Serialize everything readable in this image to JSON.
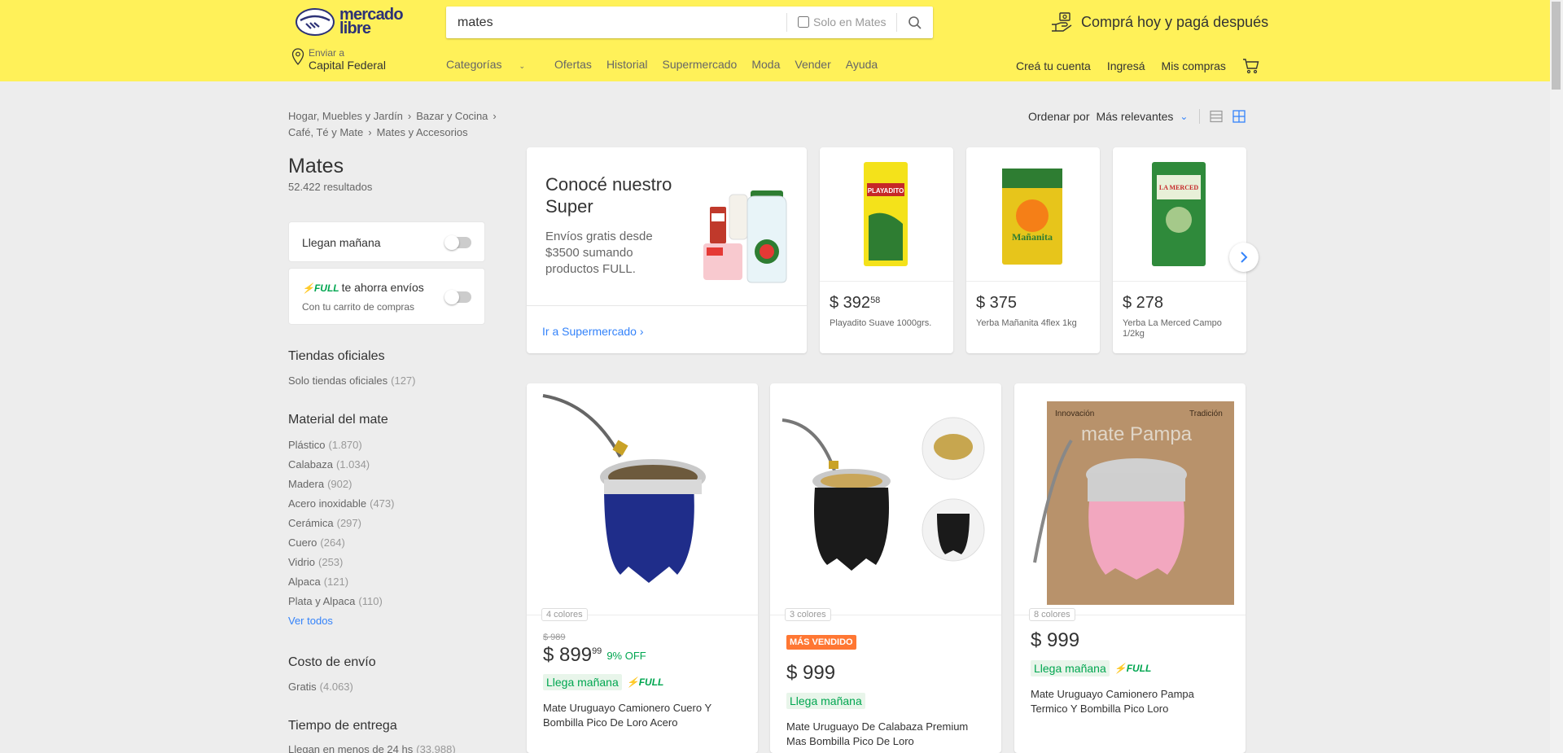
{
  "header": {
    "logo_text": "mercado libre",
    "search_value": "mates",
    "search_scope_label": "Solo en Mates",
    "promo_text": "Comprá hoy y pagá después",
    "location_small": "Enviar a",
    "location_big": "Capital Federal",
    "nav": [
      "Categorías",
      "Ofertas",
      "Historial",
      "Supermercado",
      "Moda",
      "Vender",
      "Ayuda"
    ],
    "user_nav": [
      "Creá tu cuenta",
      "Ingresá",
      "Mis compras"
    ]
  },
  "breadcrumb": [
    "Hogar, Muebles y Jardín",
    "Bazar y Cocina",
    "Café, Té y Mate",
    "Mates y Accesorios"
  ],
  "sort": {
    "label": "Ordenar por",
    "value": "Más relevantes"
  },
  "sidebar": {
    "title": "Mates",
    "results": "52.422 resultados",
    "filter_tomorrow": "Llegan mañana",
    "full_badge": "FULL",
    "full_text": "te ahorra envíos",
    "full_sub": "Con tu carrito de compras",
    "official_title": "Tiendas oficiales",
    "official_item": {
      "label": "Solo tiendas oficiales",
      "count": "(127)"
    },
    "material_title": "Material del mate",
    "materials": [
      {
        "label": "Plástico",
        "count": "(1.870)"
      },
      {
        "label": "Calabaza",
        "count": "(1.034)"
      },
      {
        "label": "Madera",
        "count": "(902)"
      },
      {
        "label": "Acero inoxidable",
        "count": "(473)"
      },
      {
        "label": "Cerámica",
        "count": "(297)"
      },
      {
        "label": "Cuero",
        "count": "(264)"
      },
      {
        "label": "Vidrio",
        "count": "(253)"
      },
      {
        "label": "Alpaca",
        "count": "(121)"
      },
      {
        "label": "Plata y Alpaca",
        "count": "(110)"
      }
    ],
    "see_all": "Ver todos",
    "shipping_title": "Costo de envío",
    "shipping_item": {
      "label": "Gratis",
      "count": "(4.063)"
    },
    "delivery_title": "Tiempo de entrega",
    "delivery_item": {
      "label": "Llegan en menos de 24 hs",
      "count": "(33.988)"
    }
  },
  "super_banner": {
    "title": "Conocé nuestro Super",
    "text": "Envíos gratis desde $3500 sumando productos FULL.",
    "link": "Ir a Supermercado"
  },
  "mini_products": [
    {
      "price": "$ 392",
      "cents": "58",
      "name": "Playadito Suave 1000grs.",
      "pack_color": "#f4e21a",
      "pack_label": "PLAYADITO"
    },
    {
      "price": "$ 375",
      "cents": "",
      "name": "Yerba Mañanita 4flex 1kg",
      "pack_color": "#e7c51b",
      "pack_label": "Mañanita"
    },
    {
      "price": "$ 278",
      "cents": "",
      "name": "Yerba La Merced Campo 1/2kg",
      "pack_color": "#2f8a3b",
      "pack_label": "LA MERCED"
    }
  ],
  "products": [
    {
      "colors": "4 colores",
      "old_price": "$ 989",
      "price": "$ 899",
      "cents": "99",
      "discount": "9% OFF",
      "delivery": "Llega mañana",
      "full": "FULL",
      "name": "Mate Uruguayo Camionero Cuero Y Bombilla Pico De Loro Acero"
    },
    {
      "colors": "3 colores",
      "badge": "MÁS VENDIDO",
      "price": "$ 999",
      "cents": "",
      "delivery": "Llega mañana",
      "name": "Mate Uruguayo De Calabaza Premium Mas Bombilla Pico De Loro"
    },
    {
      "colors": "8 colores",
      "price": "$ 999",
      "cents": "",
      "delivery": "Llega mañana",
      "full": "FULL",
      "name": "Mate Uruguayo Camionero Pampa Termico Y Bombilla Pico Loro",
      "box_left": "Innovación",
      "box_right": "Tradición",
      "box_brand": "mate Pampa"
    }
  ],
  "colors": {
    "header": "#fff159",
    "accent_blue": "#3483fa",
    "green": "#00a650",
    "best_seller": "#ff7733"
  }
}
